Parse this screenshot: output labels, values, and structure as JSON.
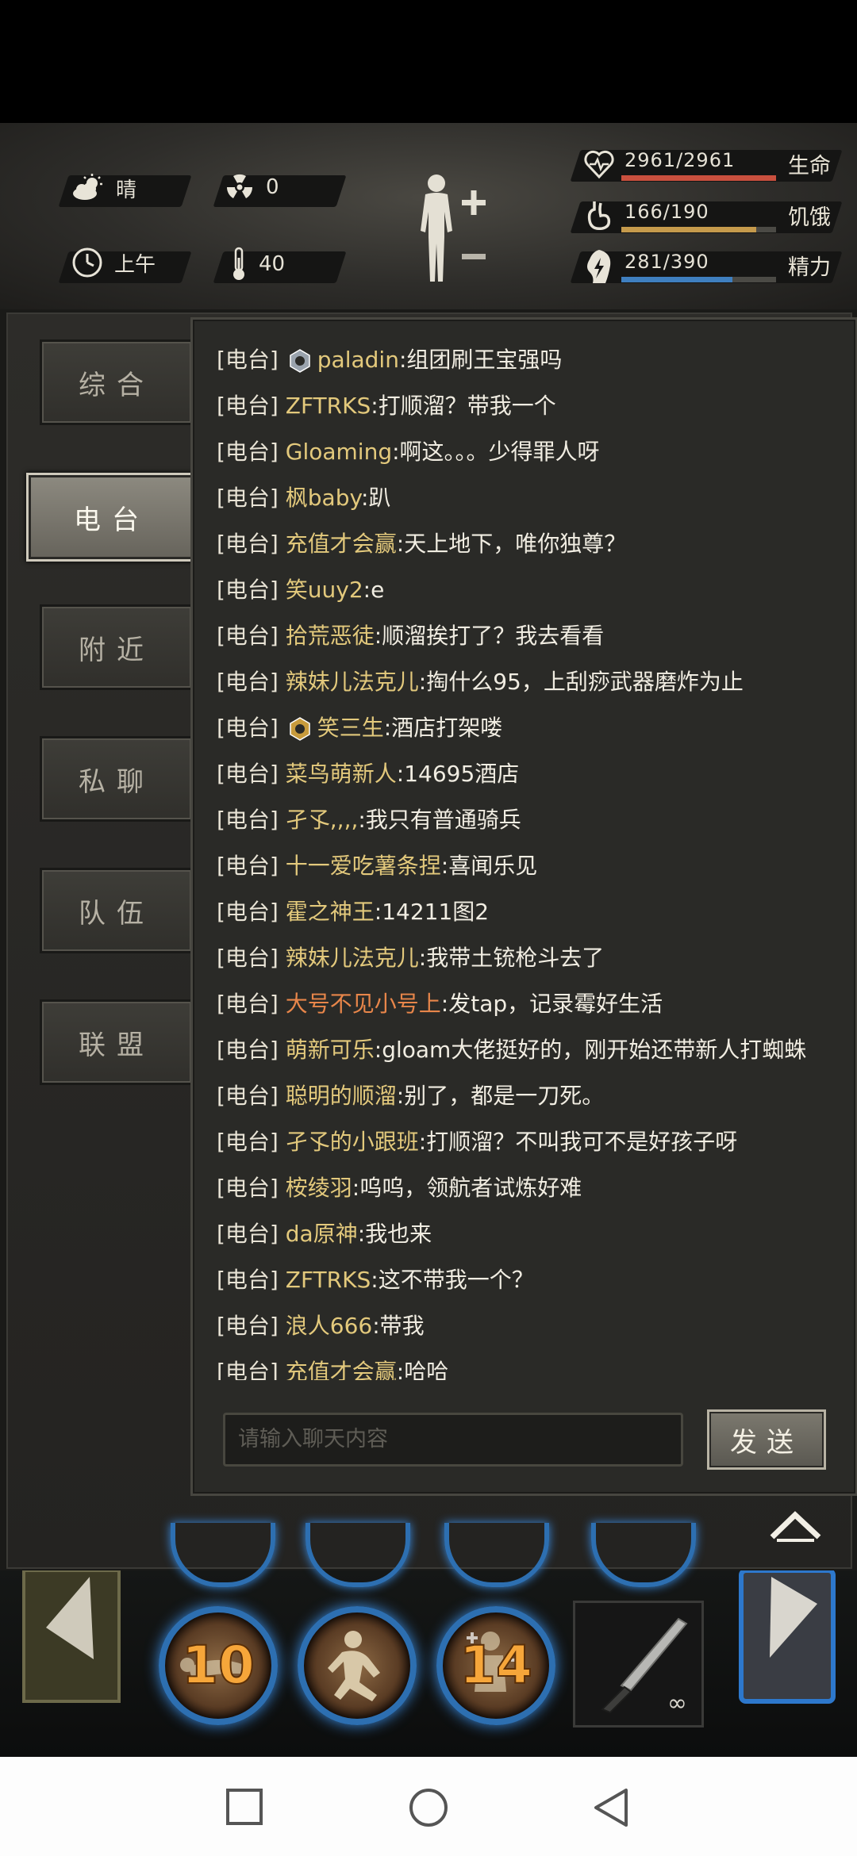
{
  "header": {
    "weather": "晴",
    "radiation": "0",
    "time_of_day": "上午",
    "temperature": "40",
    "stats": [
      {
        "value": "2961/2961",
        "label": "生命",
        "fraction": 1.0,
        "color": "#c9503e",
        "icon": "heart-icon"
      },
      {
        "value": "166/190",
        "label": "饥饿",
        "fraction": 0.874,
        "color": "#c59a4c",
        "icon": "stomach-icon"
      },
      {
        "value": "281/390",
        "label": "精力",
        "fraction": 0.72,
        "color": "#3f7fbf",
        "icon": "energy-icon"
      }
    ]
  },
  "tabs": [
    {
      "label": "综合",
      "active": false
    },
    {
      "label": "电台",
      "active": true
    },
    {
      "label": "附近",
      "active": false
    },
    {
      "label": "私聊",
      "active": false
    },
    {
      "label": "队伍",
      "active": false
    },
    {
      "label": "联盟",
      "active": false
    }
  ],
  "chat": {
    "channel_tag": "[电台]",
    "messages": [
      {
        "name": "paladin",
        "text": ":组团刷王宝强吗",
        "badge": "silver",
        "orange": false
      },
      {
        "name": "ZFTRKS",
        "text": ":打顺溜？带我一个",
        "badge": "",
        "orange": false
      },
      {
        "name": "Gloaming",
        "text": ":啊这。。。少得罪人呀",
        "badge": "",
        "orange": false
      },
      {
        "name": "枫baby",
        "text": ":趴",
        "badge": "",
        "orange": false
      },
      {
        "name": "充值才会赢",
        "text": ":天上地下，唯你独尊？",
        "badge": "",
        "orange": false
      },
      {
        "name": "笑uuy2",
        "text": ":e",
        "badge": "",
        "orange": false
      },
      {
        "name": "拾荒恶徒",
        "text": ":顺溜挨打了？我去看看",
        "badge": "",
        "orange": false
      },
      {
        "name": "辣妹儿法克儿",
        "text": ":掏什么95，上刮痧武器磨炸为止",
        "badge": "",
        "orange": false
      },
      {
        "name": "笑三生",
        "text": ":酒店打架喽",
        "badge": "gold",
        "orange": false
      },
      {
        "name": "菜鸟萌新人",
        "text": ":14695酒店",
        "badge": "",
        "orange": false
      },
      {
        "name": "孑孓,,,,",
        "text": ":我只有普通骑兵",
        "badge": "",
        "orange": false
      },
      {
        "name": "十一爱吃薯条捏",
        "text": ":喜闻乐见",
        "badge": "",
        "orange": false
      },
      {
        "name": "霍之神王",
        "text": ":14211图2",
        "badge": "",
        "orange": false
      },
      {
        "name": "辣妹儿法克儿",
        "text": ":我带土铳枪斗去了",
        "badge": "",
        "orange": false
      },
      {
        "name": "大号不见小号上",
        "text": ":发tap，记录霉好生活",
        "badge": "",
        "orange": true
      },
      {
        "name": "萌新可乐",
        "text": ":gloam大佬挺好的，刚开始还带新人打蜘蛛",
        "badge": "",
        "orange": false
      },
      {
        "name": "聪明的顺溜",
        "text": ":别了，都是一刀死。",
        "badge": "",
        "orange": false
      },
      {
        "name": "孑孓的小跟班",
        "text": ":打顺溜？不叫我可不是好孩子呀",
        "badge": "",
        "orange": false
      },
      {
        "name": "桉绫羽",
        "text": ":呜呜，领航者试炼好难",
        "badge": "",
        "orange": false
      },
      {
        "name": "da原神",
        "text": ":我也来",
        "badge": "",
        "orange": false
      },
      {
        "name": "ZFTRKS",
        "text": ":这不带我一个？",
        "badge": "",
        "orange": false
      },
      {
        "name": "浪人666",
        "text": ":带我",
        "badge": "",
        "orange": false
      },
      {
        "name": "充值才会赢",
        "text": ":哈哈",
        "badge": "",
        "orange": false
      }
    ],
    "input_placeholder": "请输入聊天内容",
    "send_label": "发送"
  },
  "skills": [
    {
      "value": "10"
    },
    {
      "value": ""
    },
    {
      "value": "14"
    }
  ],
  "weapon": {
    "durability": "∞"
  }
}
